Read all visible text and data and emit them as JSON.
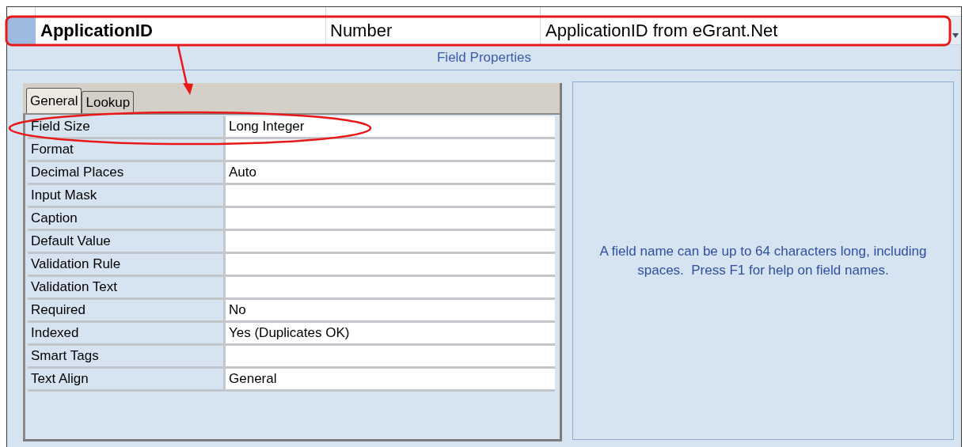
{
  "table": {
    "rows": [
      {
        "field_name": "ApplicationID",
        "data_type": "Number",
        "description": "ApplicationID from eGrant.Net",
        "selected": true
      }
    ]
  },
  "field_properties": {
    "title": "Field Properties",
    "tabs": [
      {
        "label": "General",
        "selected": true
      },
      {
        "label": "Lookup",
        "selected": false
      }
    ],
    "properties": [
      {
        "name": "Field Size",
        "value": "Long Integer"
      },
      {
        "name": "Format"
      },
      {
        "name": "Decimal Places",
        "value": "Auto"
      },
      {
        "name": "Input Mask"
      },
      {
        "name": "Caption"
      },
      {
        "name": "Default Value"
      },
      {
        "name": "Validation Rule"
      },
      {
        "name": "Validation Text"
      },
      {
        "name": "Required",
        "value": "No"
      },
      {
        "name": "Indexed",
        "value": "Yes (Duplicates OK)"
      },
      {
        "name": "Smart Tags"
      },
      {
        "name": "Text Align",
        "value": "General"
      }
    ],
    "help_text": "A field name can be up to 64 characters long, including spaces.  Press F1 for help on field names."
  }
}
